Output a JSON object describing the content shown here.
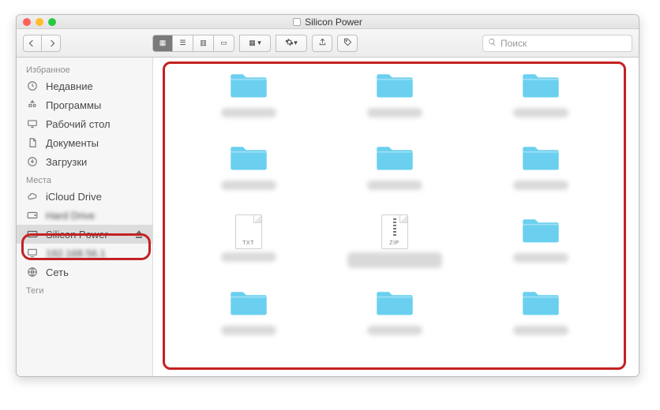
{
  "window": {
    "title": "Silicon Power"
  },
  "toolbar": {
    "search_placeholder": "Поиск"
  },
  "sidebar": {
    "sections": [
      {
        "title": "Избранное",
        "items": [
          {
            "icon": "clock-icon",
            "label": "Недавние"
          },
          {
            "icon": "apps-icon",
            "label": "Программы"
          },
          {
            "icon": "desktop-icon",
            "label": "Рабочий стол"
          },
          {
            "icon": "documents-icon",
            "label": "Документы"
          },
          {
            "icon": "downloads-icon",
            "label": "Загрузки"
          }
        ]
      },
      {
        "title": "Места",
        "items": [
          {
            "icon": "cloud-icon",
            "label": "iCloud Drive"
          },
          {
            "icon": "drive-icon",
            "label": "Hard Drive",
            "blurred": true
          },
          {
            "icon": "drive-icon",
            "label": "Silicon Power",
            "selected": true,
            "ejectable": true
          },
          {
            "icon": "monitor-icon",
            "label": "192.168.56.1",
            "blurred": true
          },
          {
            "icon": "globe-icon",
            "label": "Сеть"
          }
        ]
      },
      {
        "title": "Теги",
        "items": []
      }
    ]
  },
  "content": {
    "items": [
      {
        "type": "folder"
      },
      {
        "type": "folder"
      },
      {
        "type": "folder"
      },
      {
        "type": "folder"
      },
      {
        "type": "folder"
      },
      {
        "type": "folder"
      },
      {
        "type": "file",
        "ext": "TXT"
      },
      {
        "type": "file",
        "ext": "ZIP",
        "zip": true
      },
      {
        "type": "folder"
      },
      {
        "type": "folder"
      },
      {
        "type": "folder"
      },
      {
        "type": "folder"
      }
    ]
  },
  "colors": {
    "highlight": "#c42122",
    "folder": "#6bd0ef"
  }
}
